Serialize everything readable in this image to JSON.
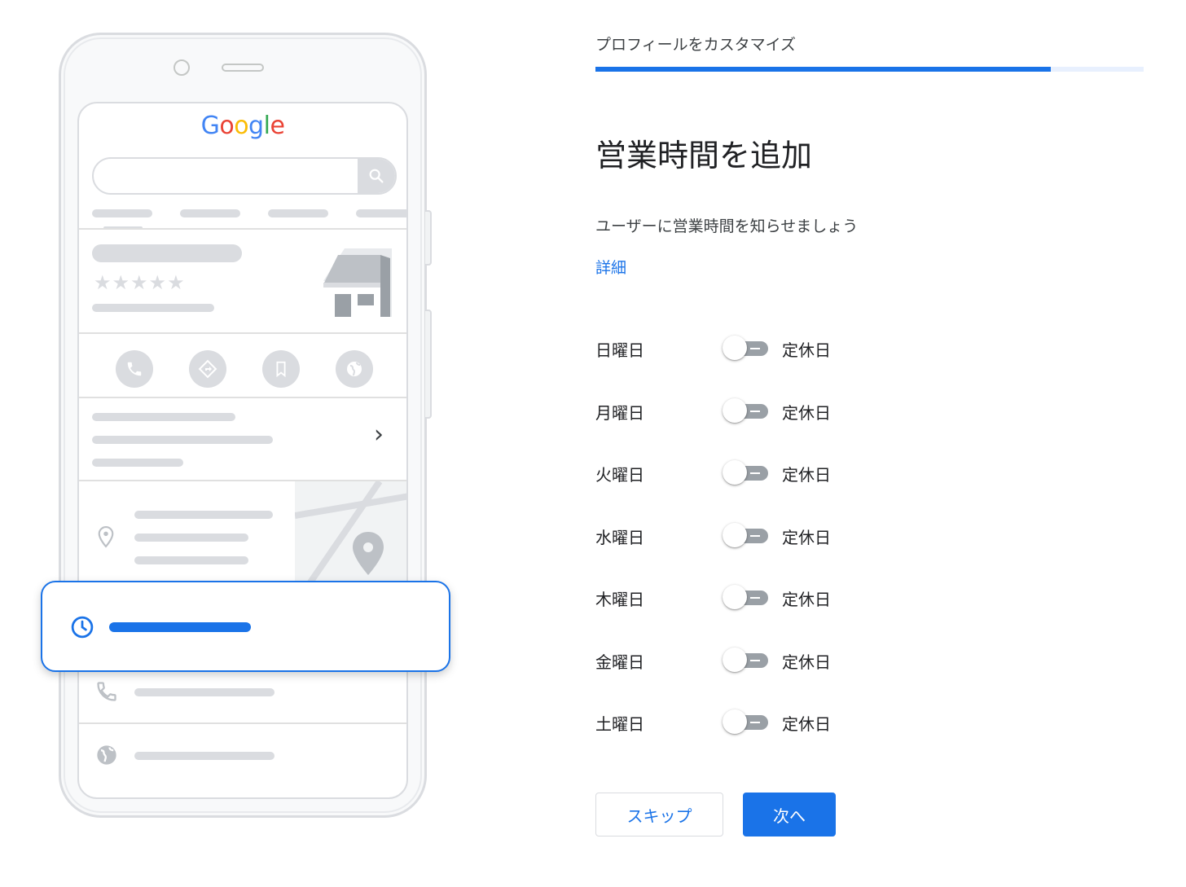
{
  "illustration": {
    "logo_letters": [
      "G",
      "o",
      "o",
      "g",
      "l",
      "e"
    ],
    "logo_colors": [
      "#4285F4",
      "#EA4335",
      "#FBBC05",
      "#4285F4",
      "#34A853",
      "#EA4335"
    ],
    "stars": "★★★★★",
    "chevron": "›",
    "icons": [
      "search-icon",
      "store-icon",
      "phone-icon",
      "directions-icon",
      "bookmark-icon",
      "globe-icon",
      "location-pin-icon",
      "map-pin-icon",
      "clock-icon"
    ]
  },
  "header": {
    "step_label": "プロフィールをカスタマイズ",
    "progress": 0.83
  },
  "main": {
    "title": "営業時間を追加",
    "subtitle": "ユーザーに営業時間を知らせましょう",
    "details_link": "詳細"
  },
  "days": [
    {
      "label": "日曜日",
      "status": "定休日",
      "open": false
    },
    {
      "label": "月曜日",
      "status": "定休日",
      "open": false
    },
    {
      "label": "火曜日",
      "status": "定休日",
      "open": false
    },
    {
      "label": "水曜日",
      "status": "定休日",
      "open": false
    },
    {
      "label": "木曜日",
      "status": "定休日",
      "open": false
    },
    {
      "label": "金曜日",
      "status": "定休日",
      "open": false
    },
    {
      "label": "土曜日",
      "status": "定休日",
      "open": false
    }
  ],
  "buttons": {
    "skip": "スキップ",
    "next": "次へ"
  },
  "colors": {
    "accent": "#1a73e8",
    "toggle_off": "#9aa0a6",
    "placeholder_gray": "#dadce0"
  }
}
